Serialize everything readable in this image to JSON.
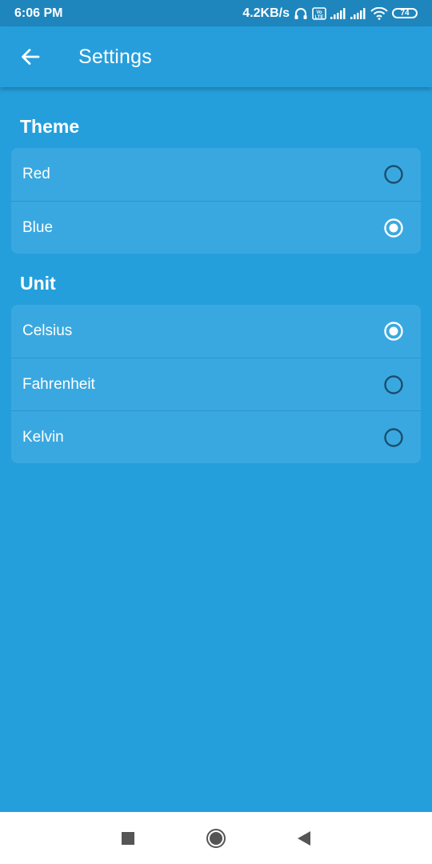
{
  "status_bar": {
    "time": "6:06 PM",
    "network_speed": "4.2KB/s",
    "battery_level": "74",
    "icons": [
      "headphones-icon",
      "volte-icon",
      "signal-icon",
      "signal-icon",
      "wifi-icon",
      "battery-icon"
    ]
  },
  "app_bar": {
    "back_icon": "arrow-left-icon",
    "title": "Settings"
  },
  "sections": [
    {
      "title": "Theme",
      "options": [
        {
          "label": "Red",
          "selected": false
        },
        {
          "label": "Blue",
          "selected": true
        }
      ]
    },
    {
      "title": "Unit",
      "options": [
        {
          "label": "Celsius",
          "selected": true
        },
        {
          "label": "Fahrenheit",
          "selected": false
        },
        {
          "label": "Kelvin",
          "selected": false
        }
      ]
    }
  ],
  "colors": {
    "background": "#259fdc",
    "status_bar": "#1f86bd",
    "card": "#3aa8e0",
    "radio_unselected": "#1b4e6e",
    "radio_selected": "#ffffff"
  },
  "nav_bar": {
    "icons": [
      "recents-square-icon",
      "home-circle-icon",
      "back-triangle-icon"
    ]
  }
}
